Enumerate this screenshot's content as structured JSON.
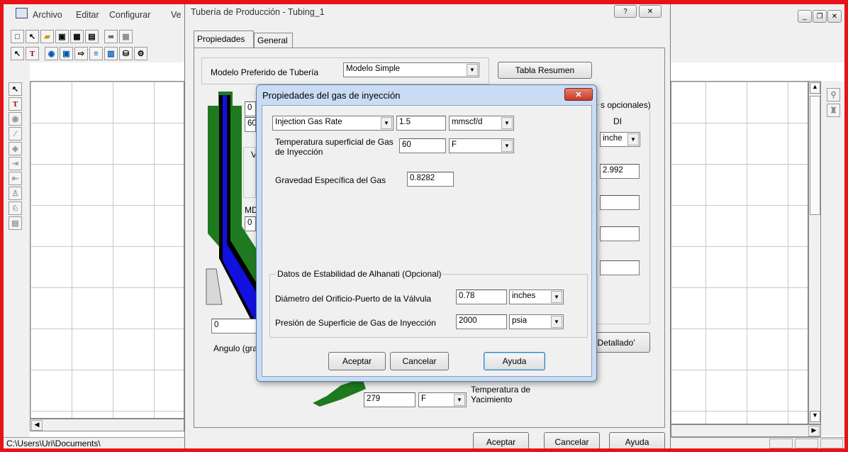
{
  "main_menu": {
    "archivo": "Archivo",
    "editar": "Editar",
    "configurar": "Configurar",
    "ver": "Ve"
  },
  "status_bar": {
    "path": "C:\\Users\\Uri\\Documents\\"
  },
  "tubing_window": {
    "title": "Tubería de Producción - Tubing_1",
    "help_btn": "?",
    "close_btn": "✕",
    "tabs": [
      "Propiedades",
      "General"
    ],
    "modelo_label": "Modelo Preferido de Tubería",
    "modelo_value": "Modelo Simple",
    "tabla_resumen": "Tabla Resumen",
    "opcionales": "s opcionales)",
    "di_label": "DI",
    "di_unit": "inche",
    "di_value": "2.992",
    "left_field_0": "0",
    "left_field_60": "60",
    "v_label": "V",
    "md_label": "MD",
    "md_value": "0",
    "bottom_zero": "0",
    "angulo_label": "Angulo (gra",
    "detallado": "Detallado'",
    "temp_value": "279",
    "temp_unit": "F",
    "temp_label": [
      "Temperatura de",
      "Yacimiento"
    ],
    "aceptar": "Aceptar",
    "cancelar": "Cancelar",
    "ayuda": "Ayuda"
  },
  "gas_dialog": {
    "title": "Propiedades del gas de inyección",
    "close_btn": "✕",
    "rate_type": "Injection Gas Rate",
    "rate_value": "1.5",
    "rate_unit": "mmscf/d",
    "temp_label": [
      "Temperatura superficial de Gas",
      "de Inyección"
    ],
    "temp_value": "60",
    "temp_unit": "F",
    "gravedad_label": "Gravedad Específica del Gas",
    "gravedad_value": "0.8282",
    "stability_group": "Datos de Estabilidad de Alhanati (Opcional)",
    "diametro_label": "Diámetro del Orificio-Puerto de la Válvula",
    "diametro_value": "0.78",
    "diametro_unit": "inches",
    "presion_label": "Presión de Superficie de Gas de Inyección",
    "presion_value": "2000",
    "presion_unit": "psia",
    "aceptar": "Aceptar",
    "cancelar": "Cancelar",
    "ayuda": "Ayuda"
  },
  "mdi_controls": {
    "min": "_",
    "restore": "❐",
    "close": "✕"
  },
  "colors": {
    "frame": "#e8121a",
    "pipe_green": "#1f7a1f",
    "pipe_blue": "#1010e0",
    "dialog_title": "#c9dcf3",
    "close_red": "#c8392b"
  }
}
